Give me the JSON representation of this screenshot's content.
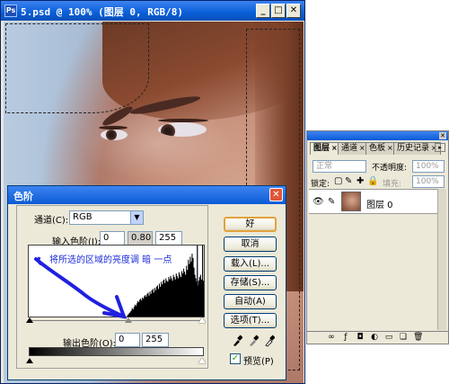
{
  "document": {
    "title": "5.psd @ 100% (图层 0, RGB/8)",
    "minimize_glyph": "_",
    "maximize_glyph": "□",
    "close_glyph": "✕"
  },
  "levels_dialog": {
    "title": "色阶",
    "close_glyph": "✕",
    "channel_label": "通道(C):",
    "channel_value": "RGB",
    "input_levels_label": "输入色阶(I):",
    "input_black": "0",
    "input_gamma": "0.80",
    "input_white": "255",
    "annotation": "将所选的区域的亮度调 暗 一点",
    "output_levels_label": "输出色阶(O):",
    "output_black": "0",
    "output_white": "255",
    "buttons": {
      "ok": "好",
      "cancel": "取消",
      "load": "载入(L)...",
      "save": "存储(S)...",
      "auto": "自动(A)",
      "options": "选项(T)..."
    },
    "preview_label": "预览(P)",
    "preview_checked": true,
    "histogram": [
      0,
      0,
      0,
      0,
      0,
      0,
      0,
      0,
      0,
      0,
      0,
      0,
      0,
      0,
      0,
      0,
      0,
      0,
      0,
      0,
      0,
      0,
      0,
      0,
      0,
      0,
      0,
      0,
      0,
      0,
      0,
      0,
      0,
      0,
      0,
      0,
      0,
      0,
      0,
      0,
      0,
      0,
      0,
      0,
      0,
      0,
      0,
      0,
      0,
      0,
      0,
      0,
      0,
      0,
      0,
      0,
      0,
      0,
      0,
      0,
      0,
      0,
      0,
      0,
      0,
      0,
      0,
      0,
      0,
      0,
      0,
      0,
      0,
      0,
      0,
      0,
      0,
      0,
      0,
      0,
      0,
      0,
      0,
      0,
      0,
      0,
      0,
      0,
      0,
      0,
      0,
      0,
      0,
      0,
      0,
      0,
      0,
      0,
      0,
      0,
      0,
      0,
      0,
      0,
      0,
      2,
      4,
      6,
      8,
      10,
      14,
      12,
      16,
      20,
      18,
      22,
      26,
      24,
      28,
      30,
      27,
      32,
      30,
      34,
      36,
      33,
      38,
      40,
      35,
      42,
      38,
      44,
      46,
      40,
      48,
      44,
      50,
      52,
      46,
      55,
      50,
      58,
      54,
      60,
      62,
      56,
      64,
      60,
      58,
      66,
      62,
      68,
      64,
      60,
      70,
      66,
      62,
      72,
      68,
      64,
      74,
      70,
      66,
      76,
      72,
      80,
      75,
      70,
      85,
      78,
      95,
      88,
      100,
      92,
      105,
      98,
      82,
      70,
      64,
      58,
      52,
      60,
      66,
      70,
      62,
      56,
      60
    ],
    "hist_ticks_white": [
      0.96,
      0.99
    ]
  },
  "layers_panel": {
    "close_glyph": "✕",
    "menu_glyph": "▸",
    "tabs": [
      "图层",
      "通道",
      "色板",
      "历史记录"
    ],
    "tab_close_glyph": "×",
    "blend_mode": "正常",
    "opacity_label": "不透明度:",
    "opacity_value": "100%",
    "lock_label": "锁定:",
    "fill_label": "填充:",
    "fill_value": "100%",
    "layer_name": "图层 0"
  },
  "colors": {
    "title_blue": "#0a5fd8",
    "annotation_blue": "#1a2ad8",
    "arrow_blue": "#2020e0"
  }
}
